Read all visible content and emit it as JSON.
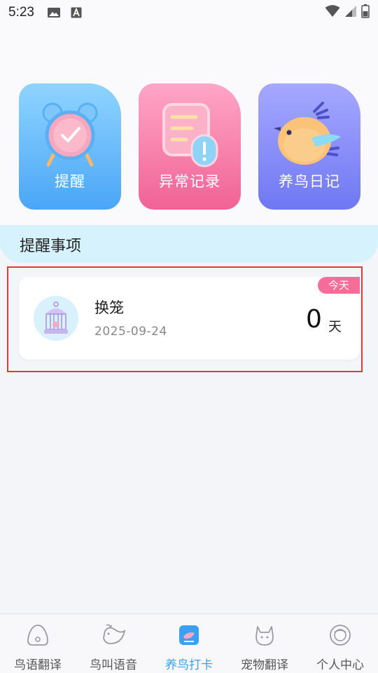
{
  "status_bar": {
    "time": "5:23",
    "icons": [
      "image-icon",
      "a-icon",
      "wifi-icon",
      "signal-icon",
      "battery-icon"
    ]
  },
  "features": [
    {
      "label": "提醒",
      "icon": "alarm-clock-icon",
      "color": "#4aa6f7"
    },
    {
      "label": "异常记录",
      "icon": "document-alert-icon",
      "color": "#f06394"
    },
    {
      "label": "养鸟日记",
      "icon": "bird-icon",
      "color": "#6f78f3"
    }
  ],
  "reminders_section": {
    "title": "提醒事项"
  },
  "reminder": {
    "name": "换笼",
    "date": "2025-09-24",
    "badge": "今天",
    "count": "0",
    "unit": "天",
    "icon": "bird-cage-icon"
  },
  "bottom_nav": {
    "items": [
      {
        "label": "鸟语翻译",
        "icon": "egg-icon",
        "active": false
      },
      {
        "label": "鸟叫语音",
        "icon": "bird-sound-icon",
        "active": false
      },
      {
        "label": "养鸟打卡",
        "icon": "checkin-icon",
        "active": true
      },
      {
        "label": "宠物翻译",
        "icon": "cat-icon",
        "active": false
      },
      {
        "label": "个人中心",
        "icon": "profile-icon",
        "active": false
      }
    ],
    "active_color": "#3ba0f0"
  }
}
